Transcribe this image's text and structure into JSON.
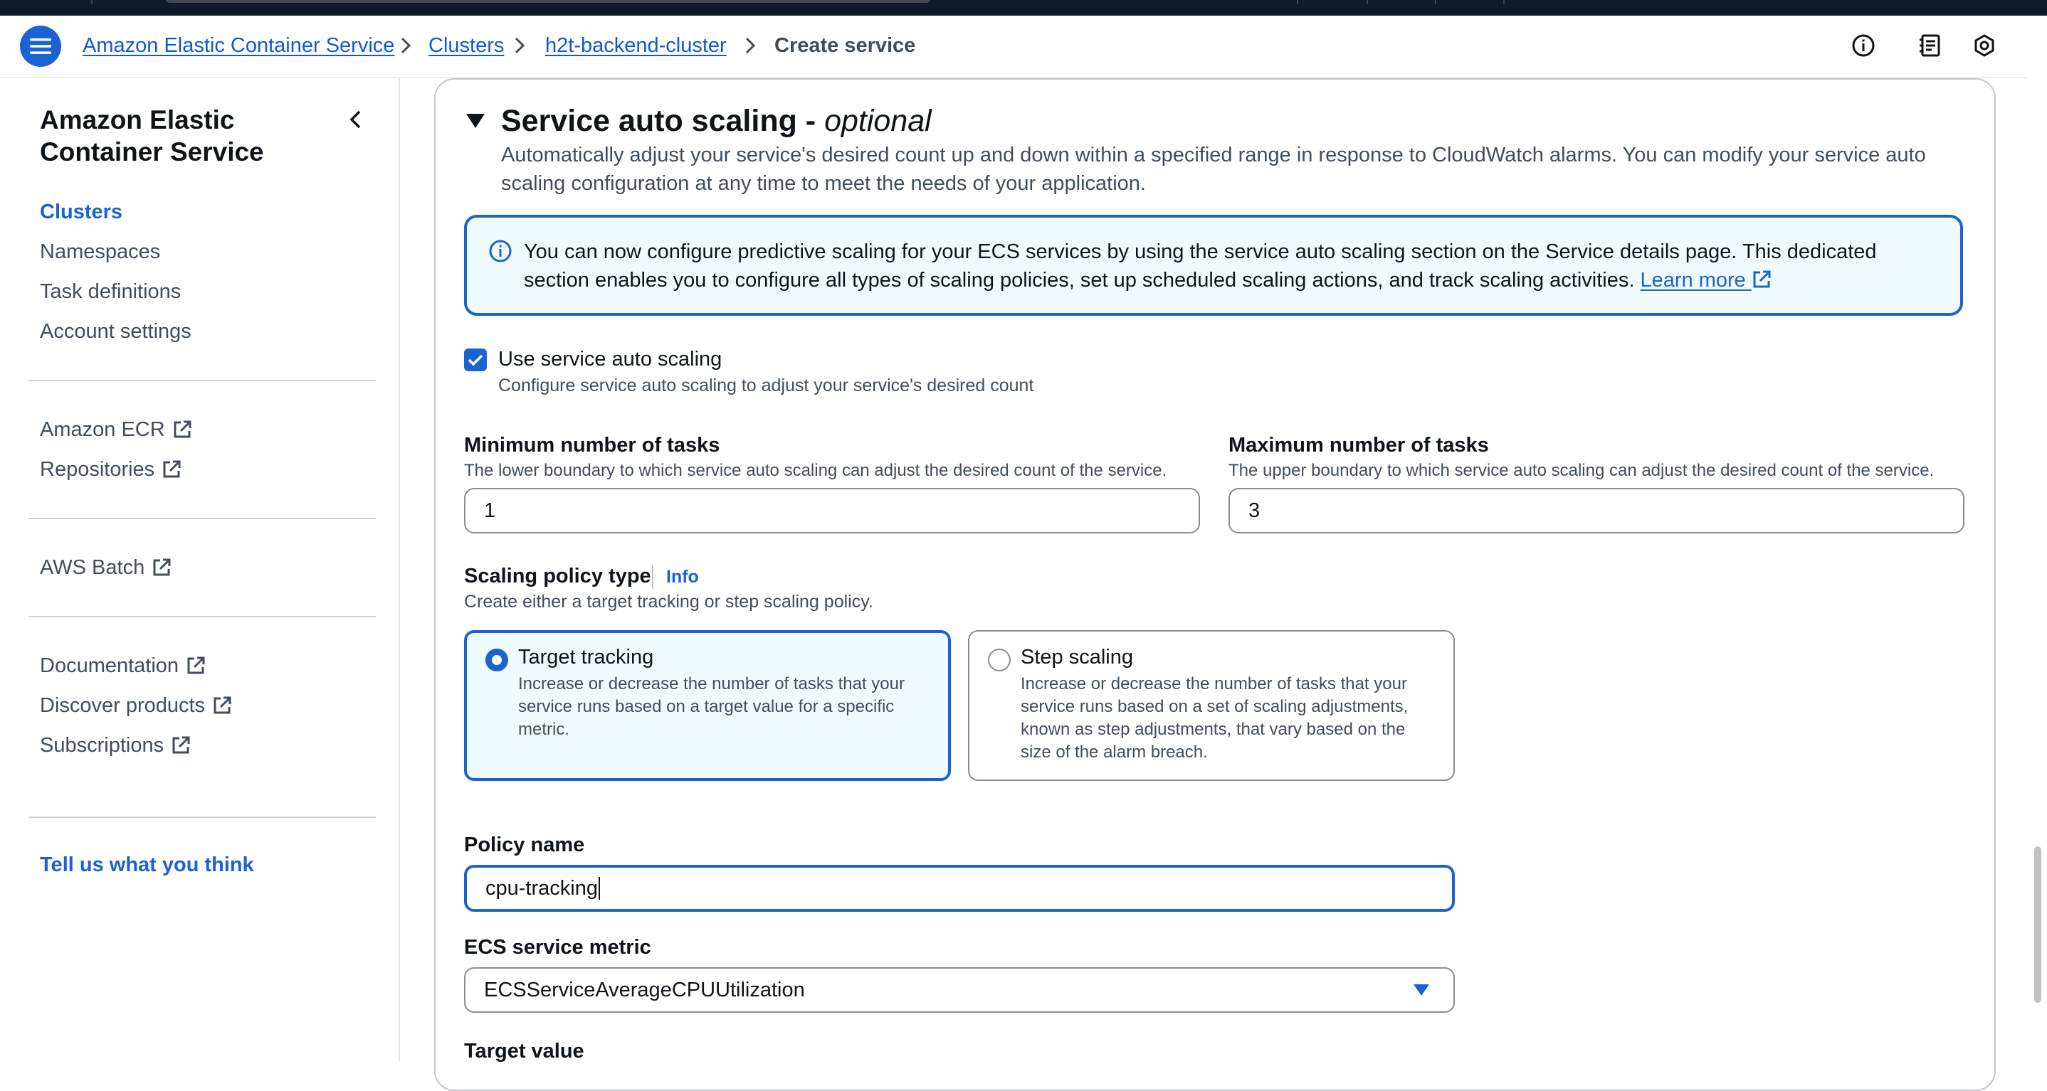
{
  "breadcrumb": {
    "items": [
      {
        "label": "Amazon Elastic Container Service",
        "link": true
      },
      {
        "label": "Clusters",
        "link": true
      },
      {
        "label": "h2t-backend-cluster",
        "link": true
      },
      {
        "label": "Create service",
        "link": false
      }
    ]
  },
  "header_icons": [
    "info-icon",
    "notes-icon",
    "settings-hex-icon"
  ],
  "sidebar": {
    "title": "Amazon Elastic Container Service",
    "items": [
      {
        "label": "Clusters",
        "active": true
      },
      {
        "label": "Namespaces"
      },
      {
        "label": "Task definitions"
      },
      {
        "label": "Account settings"
      }
    ],
    "external_group_1": [
      {
        "label": "Amazon ECR",
        "external": true
      },
      {
        "label": "Repositories",
        "external": true
      }
    ],
    "external_group_2": [
      {
        "label": "AWS Batch",
        "external": true
      }
    ],
    "external_group_3": [
      {
        "label": "Documentation",
        "external": true
      },
      {
        "label": "Discover products",
        "external": true
      },
      {
        "label": "Subscriptions",
        "external": true
      }
    ],
    "feedback": "Tell us what you think"
  },
  "section": {
    "title": "Service auto scaling -",
    "title_optional": "optional",
    "description": "Automatically adjust your service's desired count up and down within a specified range in response to CloudWatch alarms. You can modify your service auto scaling configuration at any time to meet the needs of your application."
  },
  "alert": {
    "text": "You can now configure predictive scaling for your ECS services by using the service auto scaling section on the Service details page. This dedicated section enables you to configure all types of scaling policies, set up scheduled scaling actions, and track scaling activities.",
    "link": "Learn more"
  },
  "auto_scaling_checkbox": {
    "checked": true,
    "label": "Use service auto scaling",
    "description": "Configure service auto scaling to adjust your service's desired count"
  },
  "min_tasks": {
    "label": "Minimum number of tasks",
    "description": "The lower boundary to which service auto scaling can adjust the desired count of the service.",
    "value": "1"
  },
  "max_tasks": {
    "label": "Maximum number of tasks",
    "description": "The upper boundary to which service auto scaling can adjust the desired count of the service.",
    "value": "3"
  },
  "scaling_policy": {
    "label": "Scaling policy type",
    "info": "Info",
    "description": "Create either a target tracking or step scaling policy.",
    "options": [
      {
        "label": "Target tracking",
        "selected": true,
        "description": "Increase or decrease the number of tasks that your service runs based on a target value for a specific metric."
      },
      {
        "label": "Step scaling",
        "selected": false,
        "description": "Increase or decrease the number of tasks that your service runs based on a set of scaling adjustments, known as step adjustments, that vary based on the size of the alarm breach."
      }
    ]
  },
  "policy_name": {
    "label": "Policy name",
    "value": "cpu-tracking"
  },
  "ecs_metric": {
    "label": "ECS service metric",
    "value": "ECSServiceAverageCPUUtilization"
  },
  "target_value": {
    "label": "Target value"
  },
  "colors": {
    "accent": "#1b63d1",
    "alert_bg": "#f0fbff",
    "text": "#0f141a",
    "muted": "#414d5c"
  }
}
